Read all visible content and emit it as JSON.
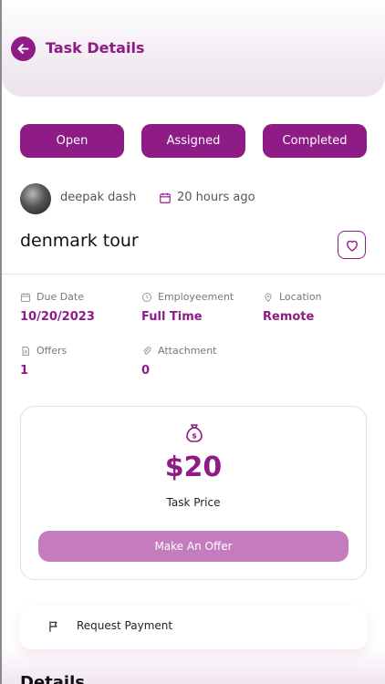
{
  "header": {
    "title": "Task Details"
  },
  "status_buttons": [
    {
      "label": "Open"
    },
    {
      "label": "Assigned"
    },
    {
      "label": "Completed"
    }
  ],
  "author": {
    "name": "deepak dash",
    "posted": "20 hours ago"
  },
  "task": {
    "title": "denmark tour"
  },
  "info": {
    "due_date": {
      "label": "Due Date",
      "value": "10/20/2023"
    },
    "employment": {
      "label": "Employeement",
      "value": "Full Time"
    },
    "location": {
      "label": "Location",
      "value": "Remote"
    },
    "offers": {
      "label": "Offers",
      "value": "1"
    },
    "attachment": {
      "label": "Attachment",
      "value": "0"
    }
  },
  "price": {
    "amount": "$20",
    "label": "Task Price",
    "offer_button": "Make An Offer"
  },
  "request_payment": {
    "label": "Request Payment"
  },
  "details": {
    "heading": "Details"
  },
  "colors": {
    "brand": "#8e1b86",
    "offer_button": "#c47cbf"
  },
  "icons": [
    "back-arrow-icon",
    "calendar-icon",
    "heart-icon",
    "clock-icon",
    "location-pin-icon",
    "document-icon",
    "paperclip-icon",
    "money-bag-icon",
    "flag-icon"
  ]
}
